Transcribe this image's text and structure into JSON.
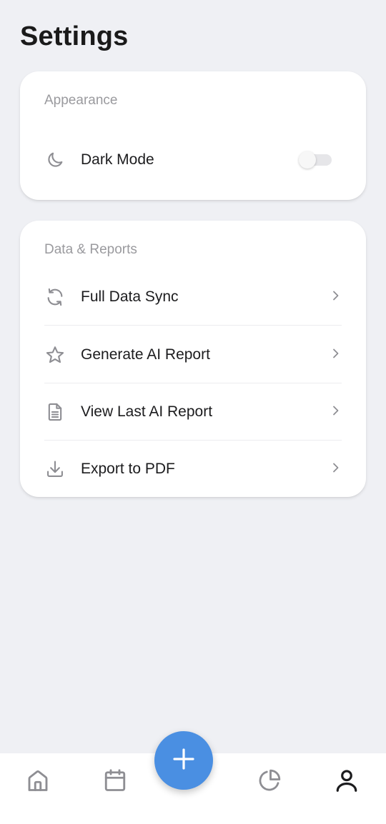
{
  "page": {
    "title": "Settings"
  },
  "appearance": {
    "header": "Appearance",
    "dark_mode": {
      "label": "Dark Mode",
      "icon": "moon-icon",
      "enabled": false
    }
  },
  "data_reports": {
    "header": "Data & Reports",
    "items": [
      {
        "label": "Full Data Sync",
        "icon": "sync-icon"
      },
      {
        "label": "Generate AI Report",
        "icon": "star-icon"
      },
      {
        "label": "View Last AI Report",
        "icon": "document-icon"
      },
      {
        "label": "Export to PDF",
        "icon": "download-icon"
      }
    ]
  },
  "tab_bar": {
    "tabs": [
      {
        "icon": "home-icon",
        "active": false
      },
      {
        "icon": "calendar-icon",
        "active": false
      },
      {
        "icon": "pie-chart-icon",
        "active": false
      },
      {
        "icon": "profile-icon",
        "active": true
      }
    ],
    "fab_icon": "plus-icon"
  },
  "colors": {
    "background": "#eff0f4",
    "card": "#ffffff",
    "accent": "#4a8fe2",
    "icon_gray": "#8e8e93",
    "text_primary": "#1c1c1e",
    "header_gray": "#9a9a9e"
  }
}
